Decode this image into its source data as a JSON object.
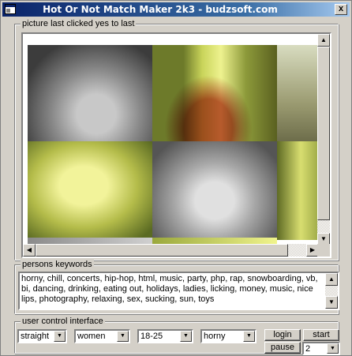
{
  "window": {
    "title": "Hot Or Not Match Maker 2k3 - budzsoft.com",
    "close_glyph": "x"
  },
  "picture_group": {
    "label": "picture last clicked yes to last"
  },
  "keywords_group": {
    "label": "persons keywords",
    "text": "horny, chill, concerts, hip-hop, html, music, party, php, rap, snowboarding, vb, bi, dancing, drinking, eating out, holidays, ladies, licking, money, music, nice lips, photography, relaxing, sex, sucking, sun, toys"
  },
  "controls_group": {
    "label": "user control interface",
    "orientation": "straight",
    "seeking": "women",
    "age_range": "18-25",
    "mood": "horny",
    "login_label": "login",
    "start_label": "start",
    "pause_label": "pause",
    "count_value": "2"
  },
  "icons": {
    "app": "app-window-icon",
    "scroll_up": "scroll-up-arrow",
    "scroll_down": "scroll-down-arrow",
    "scroll_left": "scroll-left-arrow",
    "scroll_right": "scroll-right-arrow",
    "dropdown": "dropdown-arrow"
  },
  "colors": {
    "titlebar_start": "#0a246a",
    "titlebar_end": "#a6caf0",
    "face": "#d4d0c8"
  }
}
